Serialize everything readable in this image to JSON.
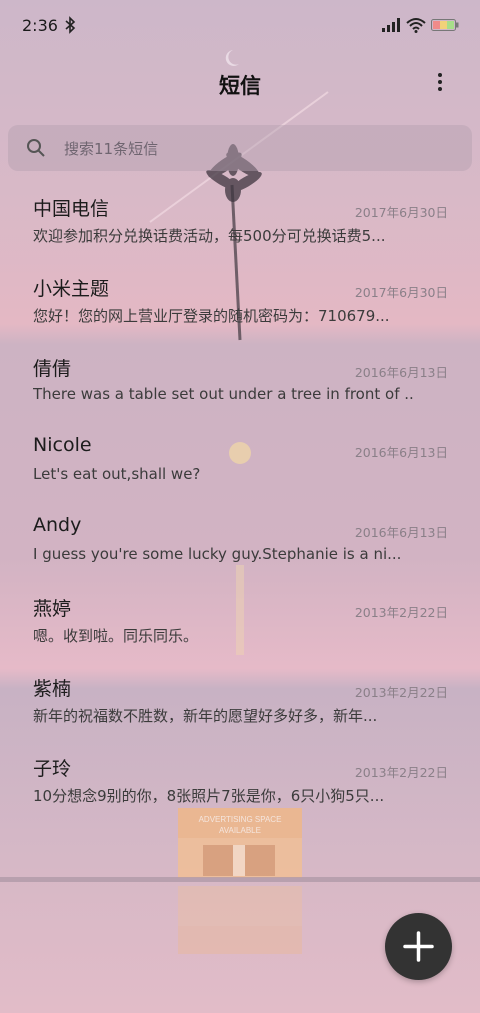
{
  "status_bar": {
    "time": "2:36"
  },
  "header": {
    "title": "短信"
  },
  "search": {
    "placeholder": "搜索11条短信"
  },
  "storefront": {
    "sign_line1": "ADVERTISING SPACE",
    "sign_line2": "AVAILABLE"
  },
  "messages": [
    {
      "sender": "中国电信",
      "date": "2017年6月30日",
      "preview": "欢迎参加积分兑换话费活动，每500分可兑换话费5..."
    },
    {
      "sender": "小米主题",
      "date": "2017年6月30日",
      "preview": "您好！您的网上营业厅登录的随机密码为：710679..."
    },
    {
      "sender": "倩倩",
      "date": "2016年6月13日",
      "preview": "There was a table set out under a tree in front of ..."
    },
    {
      "sender": "Nicole",
      "date": "2016年6月13日",
      "preview": "Let's eat out,shall we?"
    },
    {
      "sender": "Andy",
      "date": "2016年6月13日",
      "preview": "I guess you're some lucky guy.Stephanie is a ni..."
    },
    {
      "sender": "燕婷",
      "date": "2013年2月22日",
      "preview": "嗯。收到啦。同乐同乐。"
    },
    {
      "sender": "紫楠",
      "date": "2013年2月22日",
      "preview": "新年的祝福数不胜数，新年的愿望好多好多，新年..."
    },
    {
      "sender": "子玲",
      "date": "2013年2月22日",
      "preview": "10分想念9别的你，8张照片7张是你，6只小狗5只..."
    }
  ],
  "icons": {
    "bluetooth": "bluetooth-icon",
    "signal": "signal-icon",
    "wifi": "wifi-icon",
    "battery": "battery-icon",
    "more": "more-vertical-icon",
    "search": "search-icon",
    "compose": "plus-icon"
  },
  "colors": {
    "fab": "#333333",
    "background_top": "#cdb7c9",
    "background_bottom": "#e2bcc8"
  }
}
